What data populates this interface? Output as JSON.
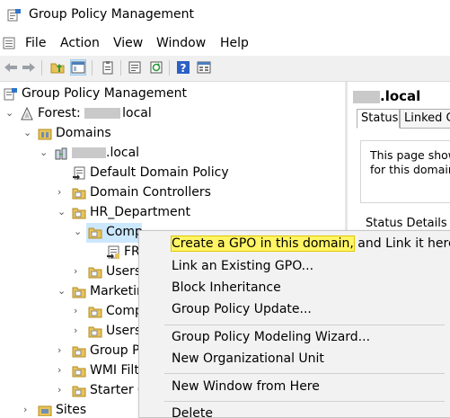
{
  "window": {
    "title": "Group Policy Management"
  },
  "menu": {
    "items": [
      "File",
      "Action",
      "View",
      "Window",
      "Help"
    ]
  },
  "tree": {
    "root": "Group Policy Management",
    "forest_prefix": "Forest: ",
    "forest_suffix": "local",
    "domains": "Domains",
    "domain_suffix": ".local",
    "default_policy": "Default Domain Policy",
    "domain_controllers": "Domain Controllers",
    "hr_department": "HR_Department",
    "hr_computers": "Comp",
    "hr_gpo": "FR",
    "hr_users": "Users",
    "marketing": "Marketin",
    "mk_computers": "Comp",
    "mk_users": "Users",
    "group_policy_objects": "Group P",
    "wmi_filters": "WMI Filt",
    "starter_gpos": "Starter G",
    "sites": "Sites"
  },
  "right_pane": {
    "title_suffix": ".local",
    "tabs": [
      "Status",
      "Linked G"
    ],
    "info_line1": "This page show",
    "info_line2": "for this domain",
    "status_details": "Status Details"
  },
  "context_menu": {
    "items": {
      "create_gpo_highlight": "Create a GPO in this domain,",
      "create_gpo_rest": " and Link it here...",
      "link_existing": "Link an Existing GPO...",
      "block_inheritance": "Block Inheritance",
      "gp_update": "Group Policy Update...",
      "modeling_wizard": "Group Policy Modeling Wizard...",
      "new_ou": "New Organizational Unit",
      "new_window": "New Window from Here",
      "delete": "Delete"
    }
  },
  "colors": {
    "selection": "#cce8ff",
    "highlight": "#fff565",
    "folder": "#e8c35a",
    "toolbar_bg": "#f0f0f0",
    "menu_bg": "#f2f2f2"
  }
}
